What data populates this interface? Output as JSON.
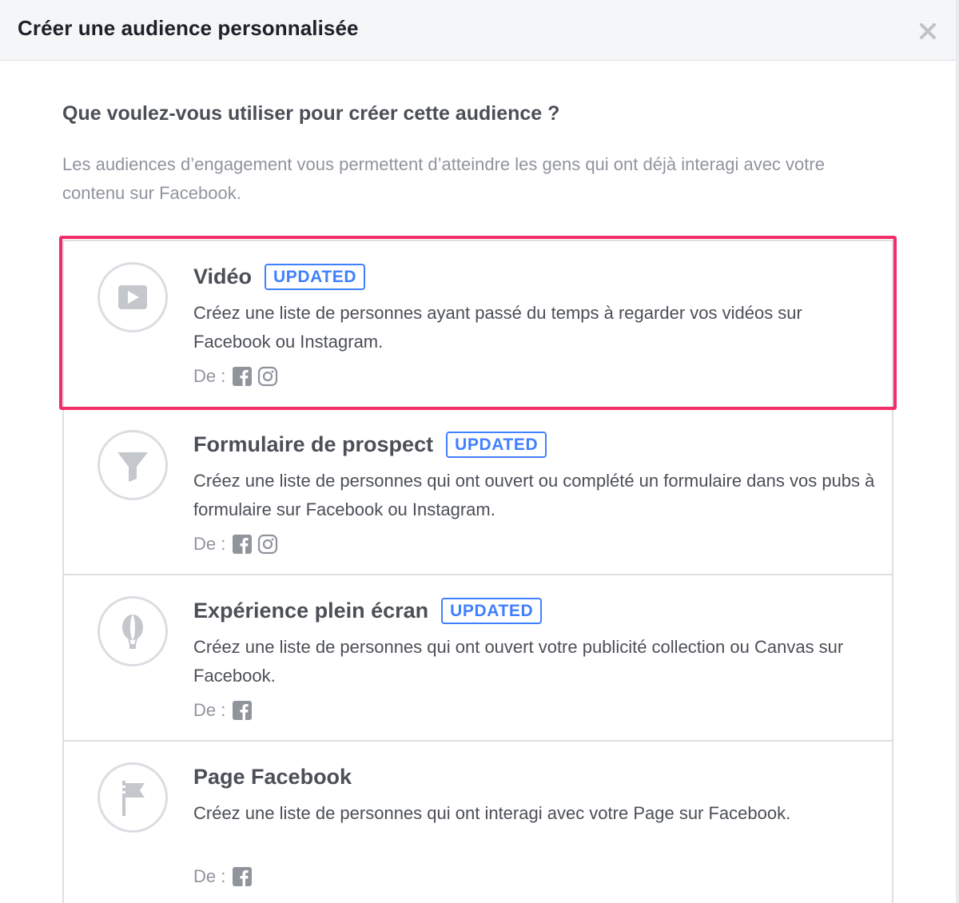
{
  "dialog": {
    "title": "Créer une audience personnalisée",
    "close_label": "×"
  },
  "question": "Que voulez-vous utiliser pour créer cette audience ?",
  "intro": "Les audiences d’engagement vous permettent d’atteindre les gens qui ont déjà interagi avec votre contenu sur Facebook.",
  "from_label": "De :",
  "badge_label": "UPDATED",
  "options": [
    {
      "title": "Vidéo",
      "badge": "UPDATED",
      "description": "Créez une liste de personnes ayant passé du temps à regarder vos vidéos sur Facebook ou Instagram.",
      "from": "De :",
      "icon": "video-play-icon",
      "sources": [
        "facebook-icon",
        "instagram-icon"
      ],
      "highlighted": true
    },
    {
      "title": "Formulaire de prospect",
      "badge": "UPDATED",
      "description": "Créez une liste de personnes qui ont ouvert ou complété un formulaire dans vos pubs à formulaire sur Facebook ou Instagram.",
      "from": "De :",
      "icon": "funnel-icon",
      "sources": [
        "facebook-icon",
        "instagram-icon"
      ]
    },
    {
      "title": "Expérience plein écran",
      "badge": "UPDATED",
      "description": "Créez une liste de personnes qui ont ouvert votre publicité collection ou Canvas sur Facebook.",
      "from": "De :",
      "icon": "balloon-icon",
      "sources": [
        "facebook-icon"
      ]
    },
    {
      "title": "Page Facebook",
      "badge": "",
      "description": "Créez une liste de personnes qui ont interagi avec votre Page sur Facebook.",
      "from": "De :",
      "icon": "flag-icon",
      "sources": [
        "facebook-icon"
      ]
    }
  ],
  "colors": {
    "highlight": "#f22e68",
    "badge": "#4080ff",
    "muted": "#90949c",
    "text": "#4b4f56",
    "icon_gray": "#c4c7cc"
  }
}
